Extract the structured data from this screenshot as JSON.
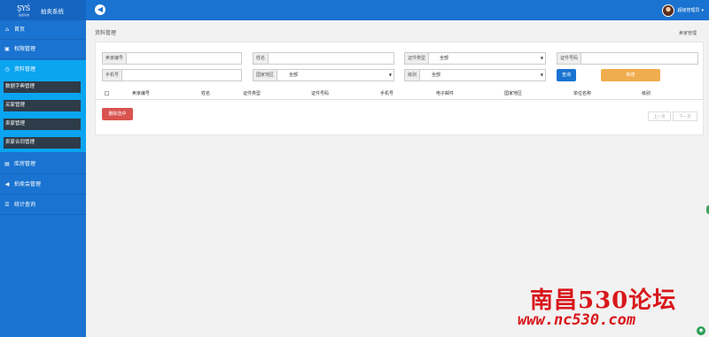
{
  "app": {
    "logo_mark": "ŞYŚ",
    "logo_sub": "拍卖系统",
    "name": "拍卖系统"
  },
  "header": {
    "back_icon": "back-arrow-icon",
    "user_name": "超级管理员",
    "user_caret": "▾"
  },
  "sidebar": {
    "items": [
      {
        "icon": "home-icon",
        "glyph": "⌂",
        "label": "首页"
      },
      {
        "icon": "lock-icon",
        "glyph": "🔒",
        "label": "权限管理"
      },
      {
        "icon": "clock-icon",
        "glyph": "◷",
        "label": "资料管理"
      },
      {
        "icon": "book-icon",
        "glyph": "▤",
        "label": "库房管理"
      },
      {
        "icon": "send-icon",
        "glyph": "◀",
        "label": "拍卖会管理"
      },
      {
        "icon": "table-icon",
        "glyph": "☰",
        "label": "统计查询"
      }
    ],
    "subitems": [
      "数据字典管理",
      "买家管理",
      "卖家管理",
      "卖家合同管理"
    ]
  },
  "breadcrumb": {
    "title": "资料管理",
    "right": "卖家管理"
  },
  "filters": {
    "seller_no": {
      "label": "卖家编号",
      "value": ""
    },
    "name": {
      "label": "姓名",
      "value": ""
    },
    "id_type": {
      "label": "证件类型",
      "value": "全部"
    },
    "id_no": {
      "label": "证件号码",
      "value": ""
    },
    "phone": {
      "label": "手机号",
      "value": ""
    },
    "region": {
      "label": "国家地区",
      "value": "全部"
    },
    "level": {
      "label": "级别",
      "value": "全部"
    }
  },
  "buttons": {
    "query": "查询",
    "add": "新增",
    "delete_selected": "删除选中"
  },
  "table": {
    "columns": [
      "卖家编号",
      "姓名",
      "证件类型",
      "证件号码",
      "手机号",
      "电子邮件",
      "国家地区",
      "单位名称",
      "级别"
    ]
  },
  "pager": {
    "prev": "上一页",
    "next": "下一页"
  },
  "watermark": {
    "title": "南昌530论坛",
    "url": "www.nc530.com"
  }
}
